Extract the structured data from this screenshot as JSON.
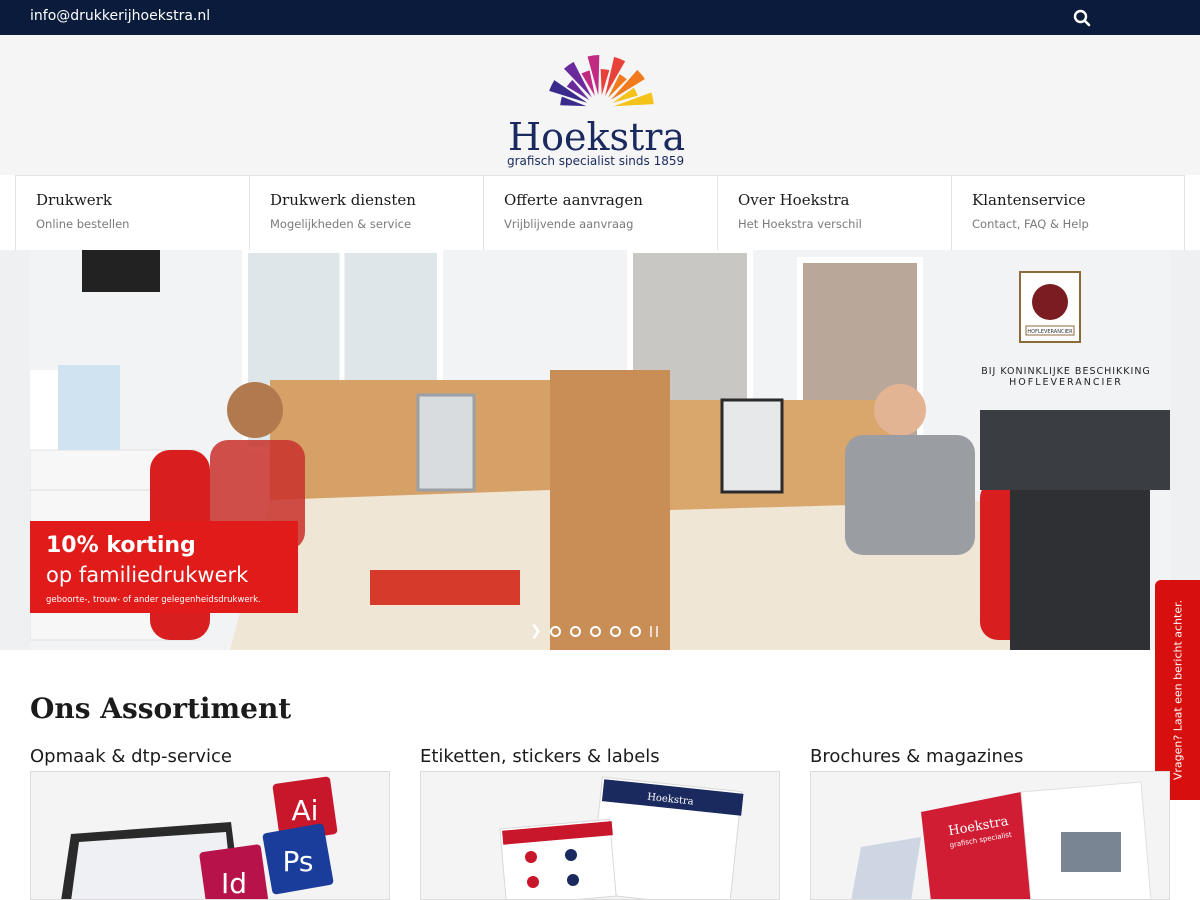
{
  "topbar": {
    "email": "info@drukkerijhoekstra.nl",
    "search_icon": "search-icon"
  },
  "logo": {
    "name": "Hoekstra",
    "tagline": "grafisch specialist sinds 1859",
    "colors": [
      "#3a2a8c",
      "#6b2a9c",
      "#c02a80",
      "#e8413a",
      "#f07a1c",
      "#f5c21a"
    ]
  },
  "nav": [
    {
      "title": "Drukwerk",
      "subtitle": "Online bestellen"
    },
    {
      "title": "Drukwerk diensten",
      "subtitle": "Mogelijkheden & service"
    },
    {
      "title": "Offerte aanvragen",
      "subtitle": "Vrijblijvende aanvraag"
    },
    {
      "title": "Over Hoekstra",
      "subtitle": "Het Hoekstra verschil"
    },
    {
      "title": "Klantenservice",
      "subtitle": "Contact, FAQ & Help"
    }
  ],
  "hero": {
    "promo_line1": "10% korting",
    "promo_line2": "op familiedrukwerk",
    "promo_line3": "geboorte-, trouw- of ander gelegenheidsdrukwerk.",
    "seal_line1": "BIJ KONINKLIJKE BESCHIKKING",
    "seal_line2": "HOFLEVERANCIER",
    "seal_badge": "HOFLEVERANCIER",
    "slide_count": 5,
    "active_slide": 1
  },
  "feedback": {
    "label": "Vragen? Laat een bericht achter."
  },
  "assortment": {
    "title": "Ons Assortiment",
    "items": [
      {
        "title": "Opmaak & dtp-service"
      },
      {
        "title": "Etiketten, stickers & labels"
      },
      {
        "title": "Brochures & magazines"
      }
    ],
    "software_icons": [
      "Ai",
      "Ps",
      "Id"
    ],
    "label_brand": "Hoekstra",
    "brochure_brand": "Hoekstra",
    "brochure_tagline": "grafisch specialist"
  },
  "colors": {
    "navy": "#0b1b3b",
    "brand_blue": "#1a2a5e",
    "accent_red": "#e11a1a",
    "feedback_red": "#d80f0f"
  }
}
